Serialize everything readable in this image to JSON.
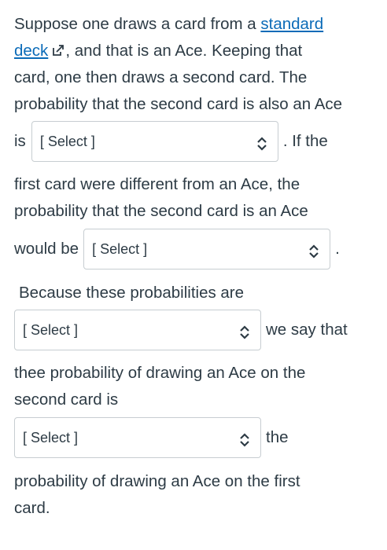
{
  "paragraph1": {
    "line1_text": "Suppose one draws a card from a ",
    "link_text": "standard",
    "line2_link_text": "deck",
    "line2_text": ", and that is an Ace.  Keeping that",
    "line3_text": "card, one then draws a second card.  The",
    "line4_text": "probability that the second card is also an Ace",
    "line5_prefix": "is",
    "line5_suffix": ". If the",
    "line6_text": "first card were different from an Ace, the",
    "line7_text": "probability that the second card is an Ace",
    "line8_prefix": "would be",
    "line8_suffix": "."
  },
  "paragraph2": {
    "line1_text": "Because these probabilities are",
    "select_suffix": "we say that",
    "line3_text": "thee probability of drawing an Ace on the",
    "line4_text": "second card is",
    "select2_suffix": "the",
    "line6_text": "probability of drawing an Ace on the first",
    "line7_text": "card."
  },
  "selects": {
    "select1": "[ Select ]",
    "select2": "[ Select ]",
    "select3": "[ Select ]",
    "select4": "[ Select ]"
  },
  "icons": {
    "external_link": "external-link-icon",
    "dropdown": "chevron-up-down-icon"
  },
  "colors": {
    "text": "#2d3b45",
    "link": "#0b6bb8",
    "border": "#c7cdd1"
  }
}
